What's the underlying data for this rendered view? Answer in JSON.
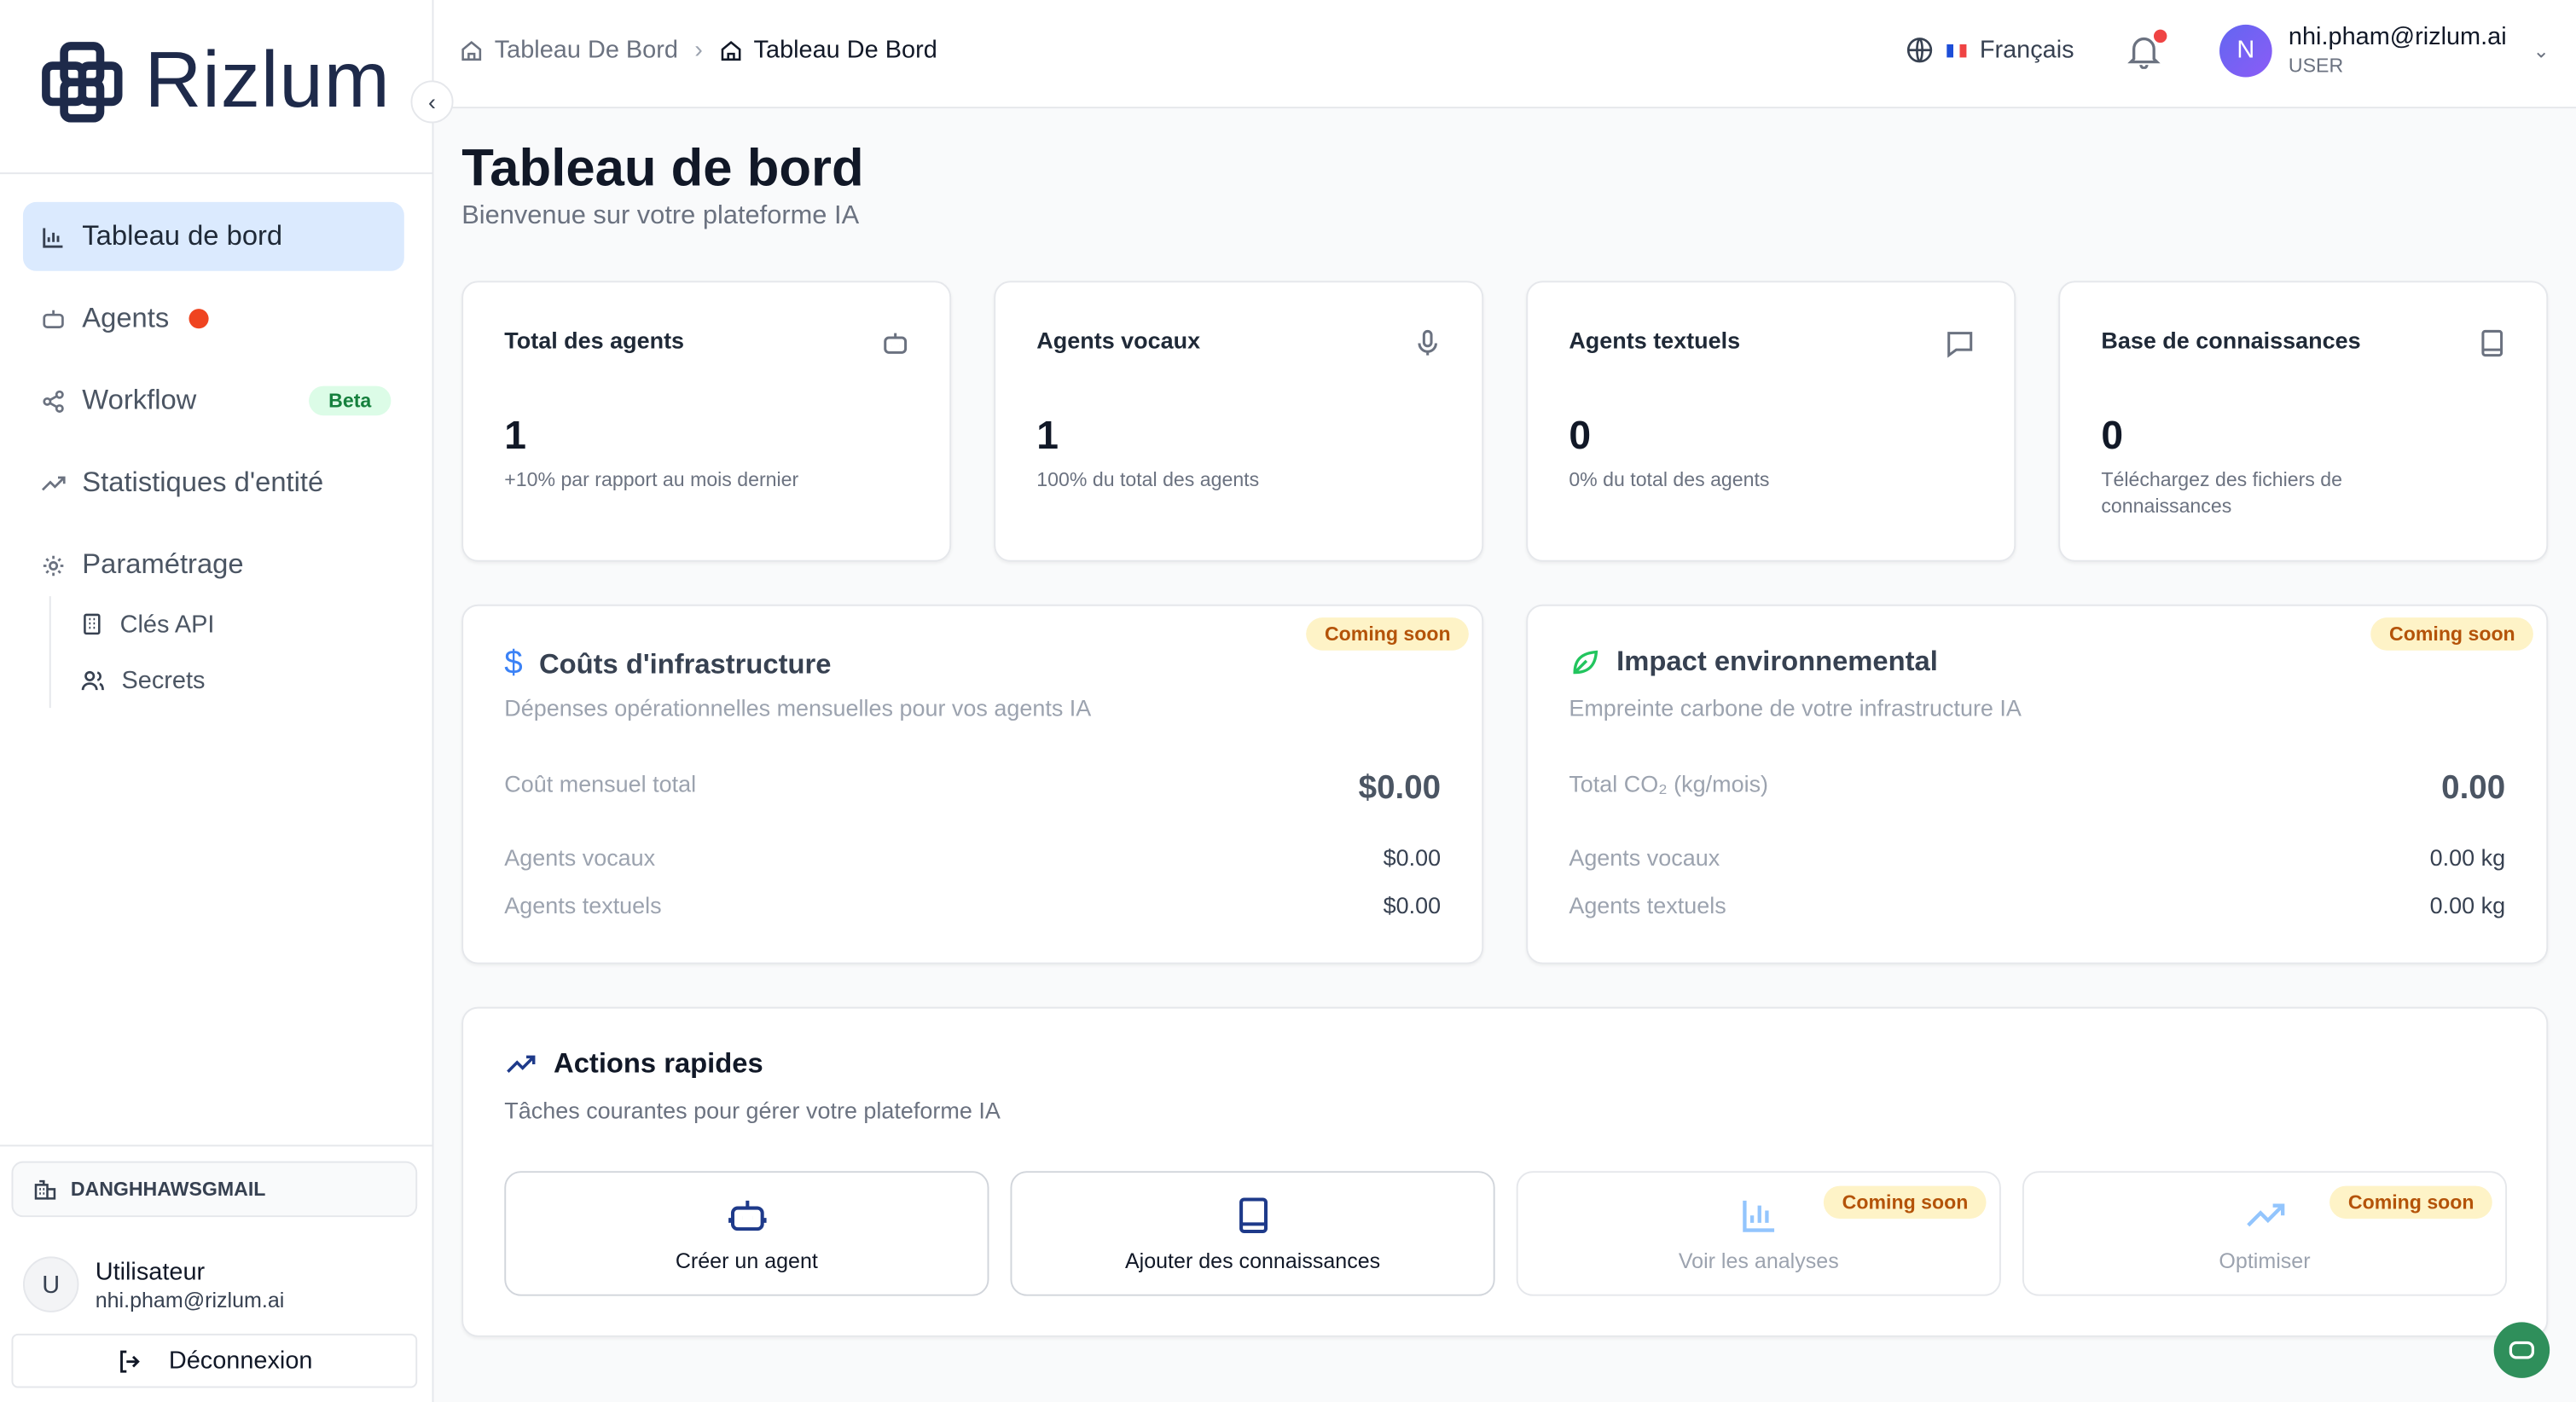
{
  "sidebar": {
    "logo_text": "Rizlum",
    "nav": [
      {
        "label": "Tableau de bord"
      },
      {
        "label": "Agents"
      },
      {
        "label": "Workflow",
        "badge": "Beta"
      },
      {
        "label": "Statistiques d'entité"
      },
      {
        "label": "Paramétrage"
      }
    ],
    "subnav": [
      {
        "label": "Clés API"
      },
      {
        "label": "Secrets"
      }
    ],
    "org_name": "DANGHHAWSGMAIL",
    "user_name": "Utilisateur",
    "user_email": "nhi.pham@rizlum.ai",
    "user_initial": "U",
    "logout_label": "Déconnexion"
  },
  "topbar": {
    "breadcrumb": [
      "Tableau De Bord",
      "Tableau De Bord"
    ],
    "language": "Français",
    "profile_initial": "N",
    "profile_email": "nhi.pham@rizlum.ai",
    "profile_role": "USER"
  },
  "page": {
    "title": "Tableau de bord",
    "subtitle": "Bienvenue sur votre plateforme IA"
  },
  "stats": [
    {
      "label": "Total des agents",
      "value": "1",
      "desc": "+10% par rapport au mois dernier",
      "icon": "bot-icon"
    },
    {
      "label": "Agents vocaux",
      "value": "1",
      "desc": "100% du total des agents",
      "icon": "mic-icon"
    },
    {
      "label": "Agents textuels",
      "value": "0",
      "desc": "0% du total des agents",
      "icon": "message-icon"
    },
    {
      "label": "Base de connaissances",
      "value": "0",
      "desc": "Téléchargez des fichiers de connaissances",
      "icon": "book-icon"
    }
  ],
  "coming_soon": "Coming soon",
  "infra": {
    "title": "Coûts d'infrastructure",
    "desc": "Dépenses opérationnelles mensuelles pour vos agents IA",
    "rows": [
      {
        "label": "Coût mensuel total",
        "value": "$0.00"
      },
      {
        "label": "Agents vocaux",
        "value": "$0.00"
      },
      {
        "label": "Agents textuels",
        "value": "$0.00"
      }
    ]
  },
  "env": {
    "title": "Impact environnemental",
    "desc": "Empreinte carbone de votre infrastructure IA",
    "rows": [
      {
        "label": "Total CO₂ (kg/mois)",
        "value": "0.00"
      },
      {
        "label": "Agents vocaux",
        "value": "0.00 kg"
      },
      {
        "label": "Agents textuels",
        "value": "0.00 kg"
      }
    ]
  },
  "quick": {
    "title": "Actions rapides",
    "desc": "Tâches courantes pour gérer votre plateforme IA",
    "actions": [
      {
        "label": "Créer un agent"
      },
      {
        "label": "Ajouter des connaissances"
      },
      {
        "label": "Voir les analyses"
      },
      {
        "label": "Optimiser"
      }
    ]
  },
  "colors": {
    "accent": "#1e3a8a",
    "active_nav": "#dbeafe",
    "soon_bg": "#fef3c7",
    "soon_fg": "#b45309"
  }
}
